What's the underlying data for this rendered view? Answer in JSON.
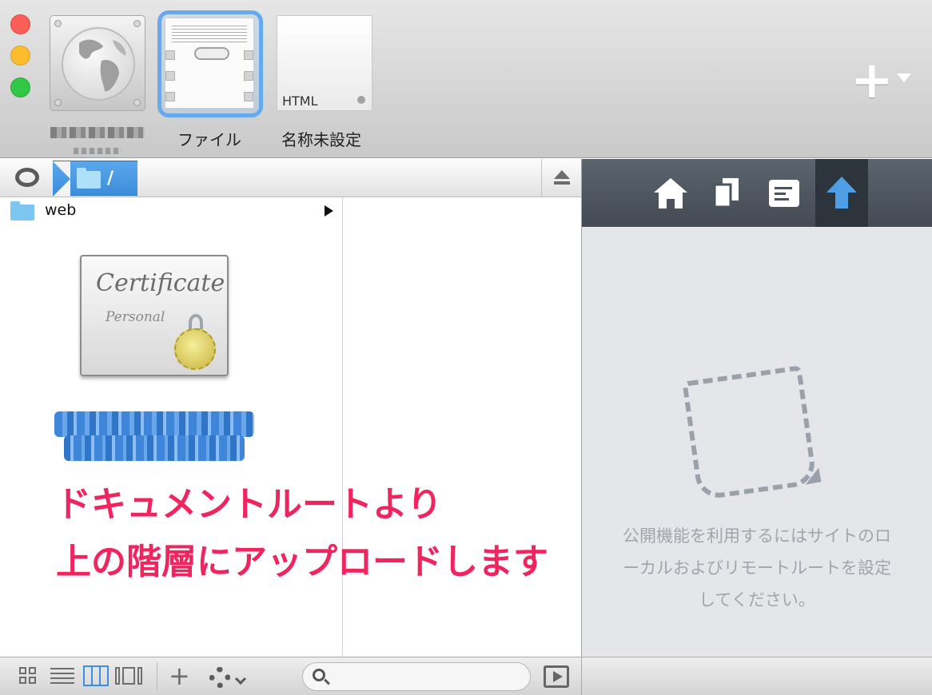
{
  "window": {
    "traffic_lights": [
      "close",
      "minimize",
      "zoom"
    ]
  },
  "sites": [
    {
      "label": "",
      "icon": "globe-icon",
      "blurred": true
    },
    {
      "label": "ファイル",
      "icon": "file-document-icon",
      "selected": true
    },
    {
      "label": "名称未設定",
      "icon": "html-page-icon",
      "thumb_text": "HTML"
    }
  ],
  "toolbar": {
    "add_site_icon": "plus-icon"
  },
  "pathbar": {
    "current_path": "/",
    "eye_icon": "eye-icon",
    "eject_icon": "eject-icon"
  },
  "browser": {
    "rows": [
      {
        "name": "web",
        "icon": "folder-icon",
        "has_children": true
      }
    ],
    "preview_icon": "certificate-icon",
    "preview_title": "Certificate",
    "preview_subtitle": "Personal",
    "selected_name_blurred": true
  },
  "annotation": {
    "line1": "ドキュメントルートより",
    "line2": "上の階層にアップロードします",
    "color": "#f0245e"
  },
  "right_panel": {
    "tabs": [
      {
        "icon": "home-icon"
      },
      {
        "icon": "copy-icon"
      },
      {
        "icon": "text-icon"
      },
      {
        "icon": "upload-arrow-icon",
        "active": true
      }
    ],
    "message": "公開機能を利用するにはサイトのロ\nーカルおよびリモートルートを設定\nしてください。"
  },
  "bottombar": {
    "views": [
      "icon-view",
      "list-view",
      "column-view",
      "coverflow-view"
    ],
    "active_view": "column-view",
    "search_placeholder": ""
  },
  "colors": {
    "accent": "#3b8ee7",
    "traffic_close": "#fc5f57",
    "traffic_min": "#fdbc2e",
    "traffic_max": "#33c748"
  }
}
